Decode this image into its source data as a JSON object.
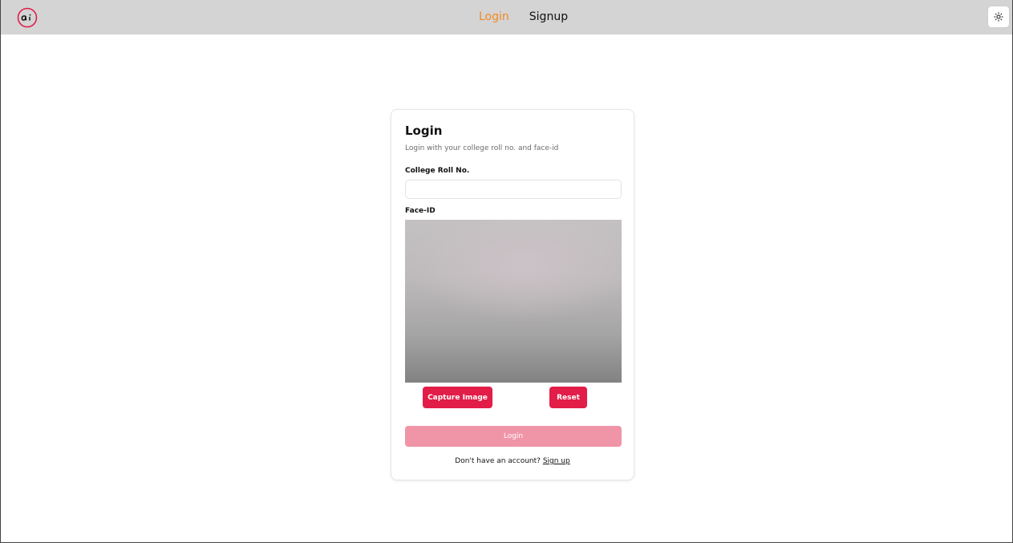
{
  "navbar": {
    "links": [
      {
        "label": "Login",
        "active": true
      },
      {
        "label": "Signup",
        "active": false
      }
    ],
    "logo_icon": "ai-logo-icon",
    "theme_icon": "sun-icon"
  },
  "login_card": {
    "title": "Login",
    "subtitle": "Login with your college roll no. and face-id",
    "roll_label": "College Roll No.",
    "roll_value": "",
    "roll_placeholder": "",
    "face_label": "Face-ID",
    "capture_label": "Capture Image",
    "reset_label": "Reset",
    "login_label": "Login",
    "signup_prompt": "Don't have an account?",
    "signup_link": "Sign up"
  },
  "colors": {
    "accent": "#e11d48",
    "accent_disabled": "#f094a8",
    "active_nav": "#f08a24",
    "navbar_bg": "#d4d4d4"
  }
}
